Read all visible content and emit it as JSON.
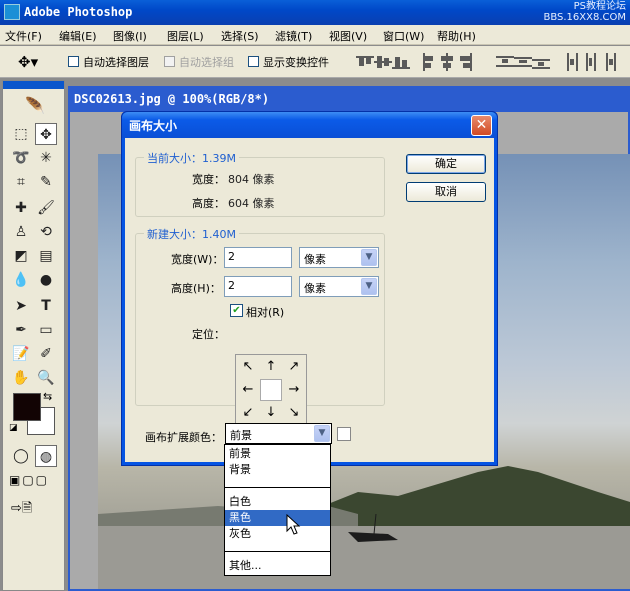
{
  "app": {
    "title": "Adobe Photoshop",
    "watermark_line1": "PS教程论坛",
    "watermark_line2": "BBS.16XX8.COM"
  },
  "menu": [
    "文件(F)",
    "编辑(E)",
    "图像(I)",
    "图层(L)",
    "选择(S)",
    "滤镜(T)",
    "视图(V)",
    "窗口(W)",
    "帮助(H)"
  ],
  "options_bar": {
    "auto_select_layer": "自动选择图层",
    "auto_select_group": "自动选择组",
    "show_transform_controls": "显示变换控件"
  },
  "document": {
    "title": "DSC02613.jpg @ 100%(RGB/8*)"
  },
  "dialog": {
    "title": "画布大小",
    "current_size_label": "当前大小：1.39M",
    "current_width_label": "宽度：",
    "current_width_value": "804 像素",
    "current_height_label": "高度：",
    "current_height_value": "604 像素",
    "new_size_label": "新建大小：1.40M",
    "width_label": "宽度(W)：",
    "width_value": "2",
    "width_unit": "像素",
    "height_label": "高度(H)：",
    "height_value": "2",
    "height_unit": "像素",
    "relative_label": "相对(R)",
    "relative_checked": true,
    "anchor_label": "定位：",
    "ok_button": "确定",
    "cancel_button": "取消",
    "extension_color_label": "画布扩展颜色：",
    "extension_color_value": "前景",
    "extension_color_options": [
      "前景",
      "背景",
      "白色",
      "黑色",
      "灰色",
      "其他..."
    ],
    "extension_color_highlighted": "黑色"
  },
  "colors": {
    "foreground": "#120404",
    "background": "#ffffff",
    "xp_blue": "#0554e3",
    "list_highlight": "#316ac5"
  }
}
